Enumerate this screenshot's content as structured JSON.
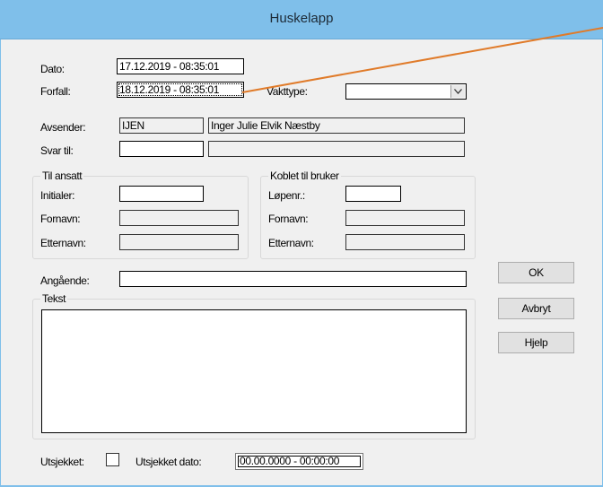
{
  "window": {
    "title": "Huskelapp"
  },
  "fields": {
    "dato": {
      "label": "Dato:",
      "value": "17.12.2019 - 08:35:01"
    },
    "forfall": {
      "label": "Forfall:",
      "value": "18.12.2019 - 08:35:01"
    },
    "vakttype": {
      "label": "Vakttype:",
      "value": ""
    },
    "avsender": {
      "label": "Avsender:",
      "initials": "IJEN",
      "name": "Inger Julie Elvik Næstby"
    },
    "svar_til": {
      "label": "Svar til:",
      "initials": "",
      "name": ""
    }
  },
  "til_ansatt": {
    "title": "Til ansatt",
    "initialer_label": "Initialer:",
    "initialer_value": "",
    "fornavn_label": "Fornavn:",
    "fornavn_value": "",
    "etternavn_label": "Etternavn:",
    "etternavn_value": ""
  },
  "koblet": {
    "title": "Koblet til bruker",
    "lopenr_label": "Løpenr.:",
    "lopenr_value": "",
    "fornavn_label": "Fornavn:",
    "fornavn_value": "",
    "etternavn_label": "Etternavn:",
    "etternavn_value": ""
  },
  "angaende": {
    "label": "Angående:",
    "value": ""
  },
  "tekst": {
    "title": "Tekst",
    "value": ""
  },
  "footer": {
    "utsjekket_label": "Utsjekket:",
    "utsjekket_checked": false,
    "utsjekket_dato_label": "Utsjekket dato:",
    "utsjekket_dato_value": "00.00.0000 - 00:00:00"
  },
  "buttons": {
    "ok": "OK",
    "avbryt": "Avbryt",
    "hjelp": "Hjelp"
  },
  "colors": {
    "titlebar": "#7fbfea",
    "dialog_bg": "#f0f0f0",
    "annotation_line": "#e07b2a"
  }
}
